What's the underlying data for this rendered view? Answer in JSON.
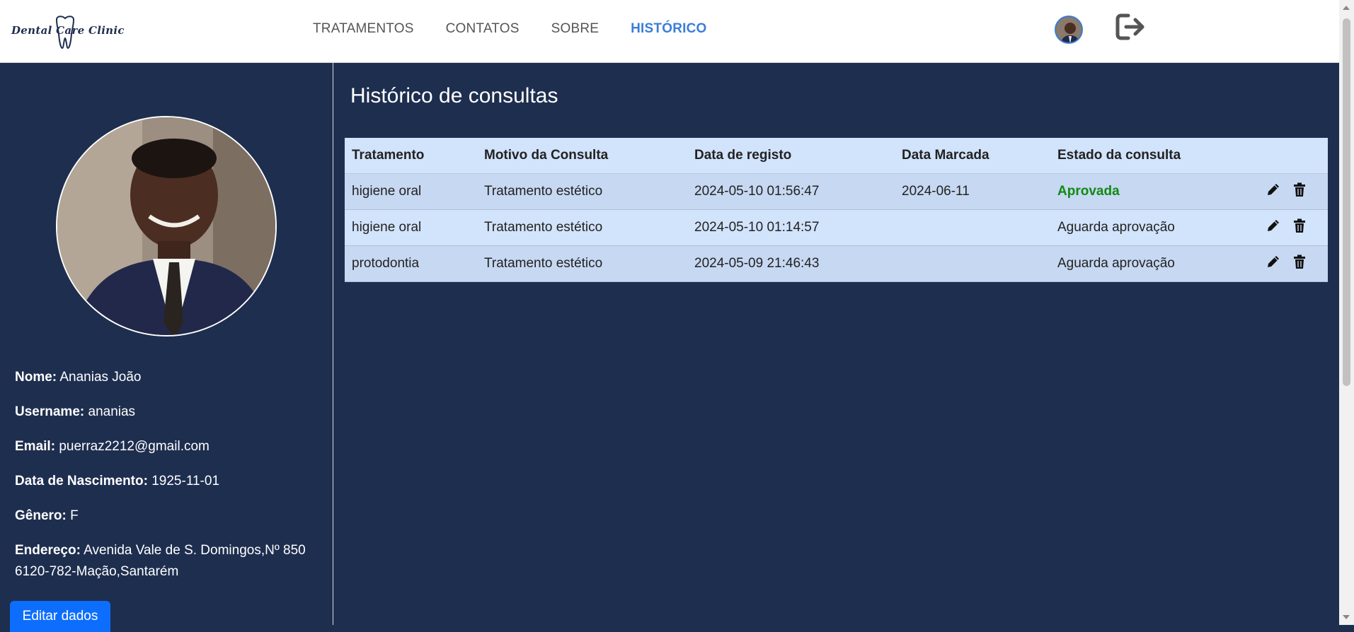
{
  "brand": {
    "logo_text": "Dental Care Clinic"
  },
  "nav": {
    "items": [
      {
        "label": "TRATAMENTOS",
        "active": false
      },
      {
        "label": "CONTATOS",
        "active": false
      },
      {
        "label": "SOBRE",
        "active": false
      },
      {
        "label": "HISTÓRICO",
        "active": true
      }
    ]
  },
  "header_icons": {
    "avatar": "user-avatar",
    "logout": "logout-icon"
  },
  "profile": {
    "fields": [
      {
        "label": "Nome:",
        "value": "Ananias João"
      },
      {
        "label": "Username:",
        "value": "ananias"
      },
      {
        "label": "Email:",
        "value": "puerraz2212@gmail.com"
      },
      {
        "label": "Data de Nascimento:",
        "value": "1925-11-01"
      },
      {
        "label": "Gênero:",
        "value": "F"
      },
      {
        "label": "Endereço:",
        "value": "Avenida Vale de S. Domingos,Nº 850",
        "value2": "6120-782-Mação,Santarém"
      }
    ],
    "edit_button": "Editar dados"
  },
  "main": {
    "title": "Histórico de consultas",
    "columns": [
      "Tratamento",
      "Motivo da Consulta",
      "Data de registo",
      "Data Marcada",
      "Estado da consulta",
      ""
    ],
    "rows": [
      {
        "tratamento": "higiene oral",
        "motivo": "Tratamento estético",
        "registo": "2024-05-10 01:56:47",
        "marcada": "2024-06-11",
        "estado": "Aprovada",
        "approved": true
      },
      {
        "tratamento": "higiene oral",
        "motivo": "Tratamento estético",
        "registo": "2024-05-10 01:14:57",
        "marcada": "",
        "estado": "Aguarda aprovação",
        "approved": false
      },
      {
        "tratamento": "protodontia",
        "motivo": "Tratamento estético",
        "registo": "2024-05-09 21:46:43",
        "marcada": "",
        "estado": "Aguarda aprovação",
        "approved": false
      }
    ],
    "row_icons": [
      "edit-icon",
      "trash-icon"
    ]
  },
  "colors": {
    "sidebar_bg": "#1e2e4f",
    "nav_active": "#3b7dd8",
    "table_header": "#d2e3fc",
    "approved": "#118a11",
    "button": "#0d6efd"
  }
}
